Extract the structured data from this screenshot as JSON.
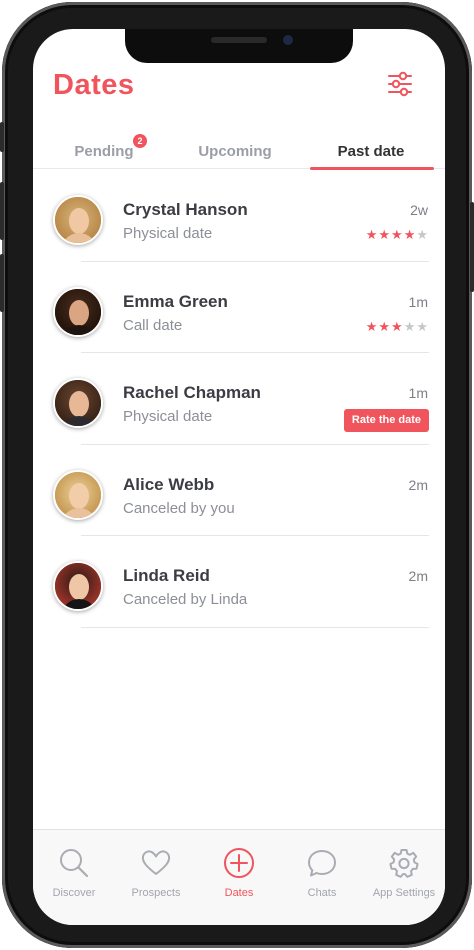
{
  "header": {
    "title": "Dates",
    "filter_icon": "sliders-icon"
  },
  "tabs": [
    {
      "label": "Pending",
      "badge": "2",
      "active": false
    },
    {
      "label": "Upcoming",
      "active": false
    },
    {
      "label": "Past date",
      "active": true
    }
  ],
  "dates": [
    {
      "name": "Crystal Hanson",
      "type": "Physical date",
      "time": "2w",
      "rating": 4,
      "max_rating": 5
    },
    {
      "name": "Emma Green",
      "type": "Call date",
      "time": "1m",
      "rating": 3,
      "max_rating": 5
    },
    {
      "name": "Rachel Chapman",
      "type": "Physical date",
      "time": "1m",
      "action": "Rate the date"
    },
    {
      "name": "Alice Webb",
      "type": "Canceled by you",
      "time": "2m"
    },
    {
      "name": "Linda Reid",
      "type": "Canceled by Linda",
      "time": "2m"
    }
  ],
  "nav": [
    {
      "label": "Discover",
      "icon": "search-icon",
      "active": false
    },
    {
      "label": "Prospects",
      "icon": "heart-icon",
      "active": false
    },
    {
      "label": "Dates",
      "icon": "plus-circle-icon",
      "active": true
    },
    {
      "label": "Chats",
      "icon": "chat-bubble-icon",
      "active": false
    },
    {
      "label": "App Settings",
      "icon": "gear-icon",
      "active": false
    }
  ],
  "colors": {
    "accent": "#f0545c",
    "text_dark": "#3c3d44",
    "text_muted": "#8c8f97",
    "star_off": "#c5c7cc"
  }
}
